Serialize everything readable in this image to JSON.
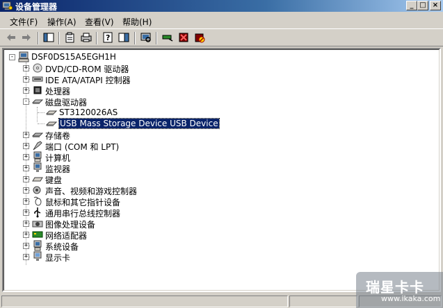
{
  "window": {
    "title": "设备管理器"
  },
  "titlebar_buttons": {
    "minimize": "_",
    "maximize": "□",
    "close": "×"
  },
  "menu": [
    {
      "label": "文件(F)"
    },
    {
      "label": "操作(A)"
    },
    {
      "label": "查看(V)"
    },
    {
      "label": "帮助(H)"
    }
  ],
  "toolbar": {
    "icons": [
      "back-icon",
      "forward-icon",
      "show-hide-console-tree-icon",
      "properties-icon",
      "print-icon",
      "help-icon",
      "action-pane-icon",
      "scan-hardware-icon",
      "update-driver-icon",
      "uninstall-icon",
      "disable-icon"
    ]
  },
  "tree": {
    "root": {
      "label": "DSF0DS15A5EGH1H",
      "icon": "computer-icon"
    },
    "items": [
      {
        "label": "DVD/CD-ROM 驱动器",
        "icon": "cdrom-icon",
        "expander": "+"
      },
      {
        "label": "IDE ATA/ATAPI 控制器",
        "icon": "ide-controller-icon",
        "expander": "+"
      },
      {
        "label": "处理器",
        "icon": "processor-icon",
        "expander": "+"
      },
      {
        "label": "磁盘驱动器",
        "icon": "disk-drive-icon",
        "expander": "-",
        "children": [
          {
            "label": "ST3120026AS",
            "icon": "hard-disk-icon"
          },
          {
            "label": "USB Mass Storage Device USB Device",
            "icon": "usb-disk-icon",
            "selected": true
          }
        ]
      },
      {
        "label": "存储卷",
        "icon": "storage-volume-icon",
        "expander": "+"
      },
      {
        "label": "端口 (COM 和 LPT)",
        "icon": "port-icon",
        "expander": "+"
      },
      {
        "label": "计算机",
        "icon": "computer-icon",
        "expander": "+"
      },
      {
        "label": "监视器",
        "icon": "monitor-icon",
        "expander": "+"
      },
      {
        "label": "键盘",
        "icon": "keyboard-icon",
        "expander": "+"
      },
      {
        "label": "声音、视频和游戏控制器",
        "icon": "sound-icon",
        "expander": "+"
      },
      {
        "label": "鼠标和其它指针设备",
        "icon": "mouse-icon",
        "expander": "+"
      },
      {
        "label": "通用串行总线控制器",
        "icon": "usb-icon",
        "expander": "+"
      },
      {
        "label": "图像处理设备",
        "icon": "imaging-icon",
        "expander": "+"
      },
      {
        "label": "网络适配器",
        "icon": "network-adapter-icon",
        "expander": "+"
      },
      {
        "label": "系统设备",
        "icon": "system-device-icon",
        "expander": "+"
      },
      {
        "label": "显示卡",
        "icon": "display-adapter-icon",
        "expander": "+"
      }
    ]
  },
  "watermark": {
    "main": "瑞星卡卡",
    "sub": "www.ikaka.com"
  },
  "colors": {
    "title_start": "#0a246a",
    "title_end": "#a6caf0",
    "selection": "#0a246a",
    "window_bg": "#d4d0c8"
  }
}
